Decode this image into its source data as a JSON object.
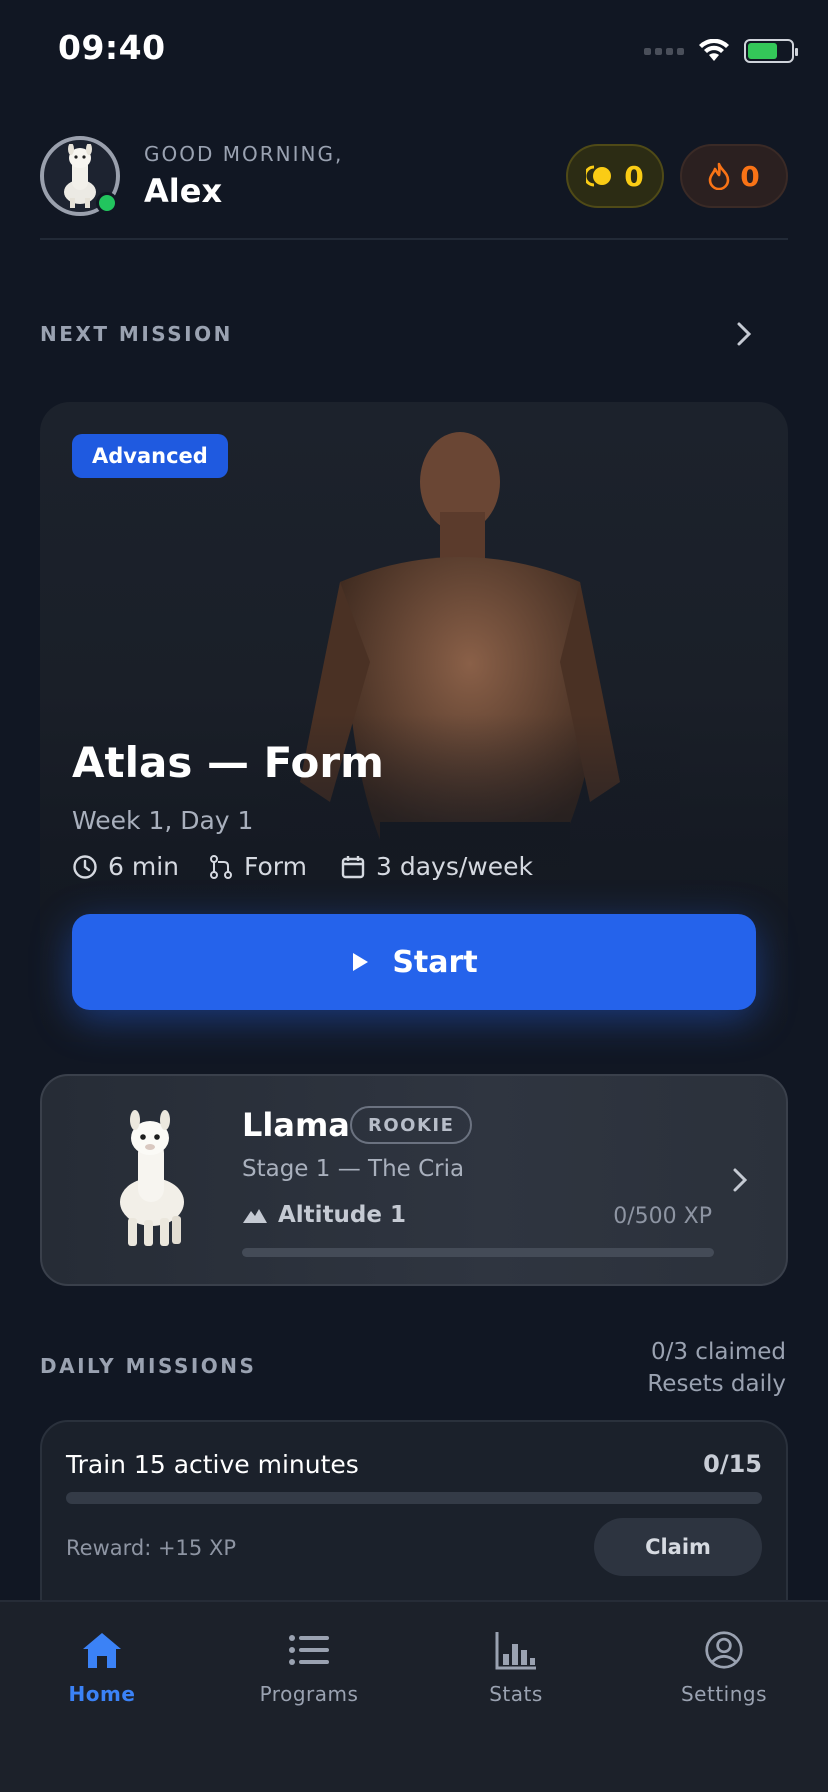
{
  "status_bar": {
    "time": "09:40"
  },
  "header": {
    "greeting": "GOOD MORNING,",
    "user_name": "Alex",
    "coins": "0",
    "streak": "0"
  },
  "next_mission": {
    "section_label": "NEXT MISSION",
    "level": "Advanced",
    "title": "Atlas — Form",
    "subtitle": "Week 1, Day 1",
    "duration": "6 min",
    "focus": "Form",
    "frequency": "3 days/week",
    "start_label": "Start"
  },
  "companion": {
    "name": "Llama",
    "rank": "ROOKIE",
    "stage": "Stage 1 — The Cria",
    "altitude": "Altitude 1",
    "xp": "0/500 XP",
    "xp_progress": 0
  },
  "daily_missions": {
    "section_label": "DAILY MISSIONS",
    "claimed": "0/3 claimed",
    "reset_note": "Resets daily",
    "items": [
      {
        "task": "Train 15 active minutes",
        "progress": "0/15",
        "progress_fraction": 0,
        "reward": "Reward: +15 XP",
        "claim_label": "Claim"
      }
    ]
  },
  "tabbar": {
    "tabs": [
      {
        "label": "Home",
        "icon": "home-icon",
        "active": true
      },
      {
        "label": "Programs",
        "icon": "list-icon",
        "active": false
      },
      {
        "label": "Stats",
        "icon": "stats-icon",
        "active": false
      },
      {
        "label": "Settings",
        "icon": "user-circle-icon",
        "active": false
      }
    ]
  },
  "colors": {
    "background": "#111723",
    "accent": "#2563eb",
    "coin": "#facc15",
    "streak": "#f97316",
    "online": "#22c55e"
  }
}
